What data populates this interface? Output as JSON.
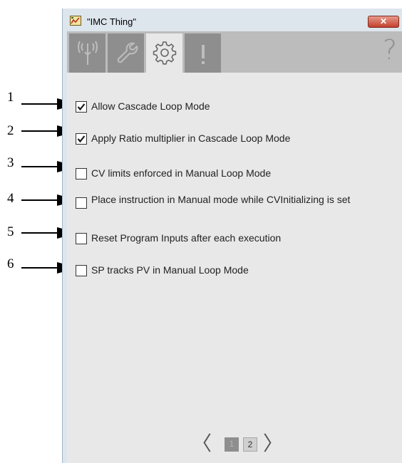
{
  "window": {
    "title": "\"IMC Thing\"",
    "close_label": "✕"
  },
  "tabs": [
    {
      "name": "signal",
      "icon": "signal-icon",
      "active": false
    },
    {
      "name": "maintenance",
      "icon": "wrench-icon",
      "active": false
    },
    {
      "name": "configuration",
      "icon": "gear-icon",
      "active": true
    },
    {
      "name": "alarms",
      "icon": "exclamation-icon",
      "active": false
    }
  ],
  "help": {
    "label": "?",
    "icon": "help-icon"
  },
  "options": [
    {
      "label": "Allow Cascade Loop Mode",
      "checked": true
    },
    {
      "label": "Apply Ratio multiplier in Cascade Loop Mode",
      "checked": true
    },
    {
      "label": "CV limits enforced in Manual Loop Mode",
      "checked": false
    },
    {
      "label": "Place instruction in Manual mode while CVInitializing is set",
      "checked": false
    },
    {
      "label": "Reset Program Inputs after each execution",
      "checked": false
    },
    {
      "label": "SP tracks PV in Manual Loop Mode",
      "checked": false
    }
  ],
  "callouts": [
    "1",
    "2",
    "3",
    "4",
    "5",
    "6"
  ],
  "pager": {
    "prev": "〈",
    "next": "〉",
    "pages": [
      "1",
      "2"
    ],
    "current": "1"
  }
}
